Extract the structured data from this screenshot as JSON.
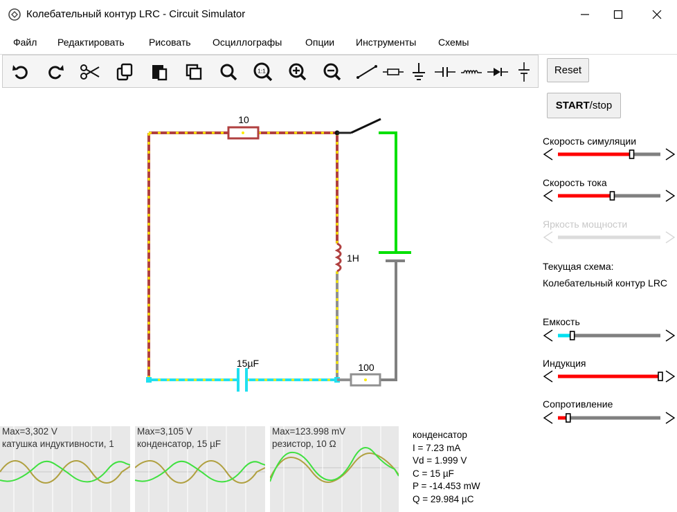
{
  "window": {
    "title": "Колебательный контур LRC - Circuit Simulator"
  },
  "menu": [
    "Файл",
    "Редактировать",
    "Рисовать",
    "Осциллографы",
    "Опции",
    "Инструменты",
    "Схемы"
  ],
  "toolbar": {
    "icons": [
      "undo-icon",
      "redo-icon",
      "cut-icon",
      "copy-icon",
      "paste-icon",
      "duplicate-icon",
      "search-icon",
      "zoom-100-icon",
      "zoom-in-icon",
      "zoom-out-icon",
      "wire-icon",
      "resistor-icon",
      "ground-icon",
      "capacitor-icon",
      "inductor-icon",
      "diode-icon",
      "battery-icon"
    ],
    "zoom_label": "1:1"
  },
  "sidebar": {
    "reset_label": "Reset",
    "start_bold": "START",
    "start_rest": "/stop",
    "sliders": [
      {
        "label": "Скорость симуляции",
        "value": 0.72,
        "fill": "#ff0000",
        "enabled": true
      },
      {
        "label": "Скорость тока",
        "value": 0.53,
        "fill": "#ff0000",
        "enabled": true
      },
      {
        "label": "Яркость мощности",
        "value": 0.0,
        "fill": "#dddddd",
        "enabled": false
      },
      {
        "label": "Емкость",
        "value": 0.14,
        "fill": "#00e0f0",
        "enabled": true
      },
      {
        "label": "Индукция",
        "value": 1.0,
        "fill": "#ff0000",
        "enabled": true
      },
      {
        "label": "Сопротивление",
        "value": 0.1,
        "fill": "#ff0000",
        "enabled": true
      }
    ],
    "circuit_title": "Текущая схема:",
    "circuit_name": "Колебательный контур LRC"
  },
  "circuit": {
    "resistor_top_label": "10",
    "inductor_label": "1H",
    "capacitor_label": "15µF",
    "resistor_bottom_label": "100"
  },
  "scopes": [
    {
      "max": "Max=3,302 V",
      "name": "катушка индуктивности, 1"
    },
    {
      "max": "Max=3,105 V",
      "name": "конденсатор, 15 µF"
    },
    {
      "max": "Max=123.998 mV",
      "name": "резистор, 10 Ω"
    }
  ],
  "info": {
    "lines": [
      "конденсатор",
      "I = 7.23 mA",
      "Vd = 1.999 V",
      "C = 15 µF",
      "P = -14.453 mW",
      "Q = 29.984 µC"
    ]
  },
  "colors": {
    "wire_red": "#b04040",
    "current_dot": "#ffee00",
    "green": "#00e000",
    "cyan": "#20e0f0",
    "gray": "#808080",
    "scope_green": "#40e040",
    "scope_olive": "#b0a040"
  }
}
